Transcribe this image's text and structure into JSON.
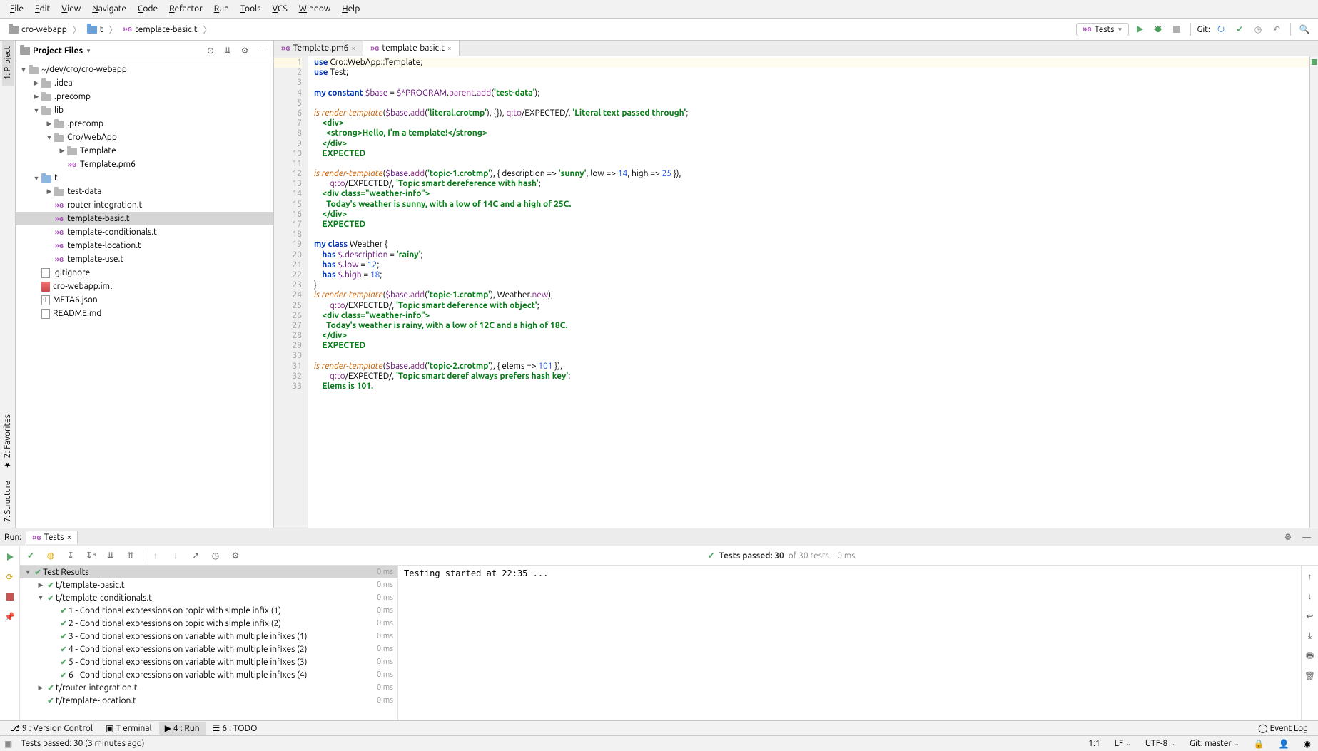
{
  "menubar": [
    "File",
    "Edit",
    "View",
    "Navigate",
    "Code",
    "Refactor",
    "Run",
    "Tools",
    "VCS",
    "Window",
    "Help"
  ],
  "breadcrumb": [
    {
      "icon": "folder",
      "label": "cro-webapp"
    },
    {
      "icon": "folder-blue",
      "label": "t"
    },
    {
      "icon": "raku",
      "label": "template-basic.t"
    }
  ],
  "run_config": {
    "icon": "raku",
    "label": "Tests"
  },
  "git_label": "Git:",
  "project_panel": {
    "title": "Project Files",
    "tree": [
      {
        "depth": 0,
        "arrow": "▼",
        "icon": "folder",
        "label": "~/dev/cro/cro-webapp"
      },
      {
        "depth": 1,
        "arrow": "▶",
        "icon": "folder",
        "label": ".idea"
      },
      {
        "depth": 1,
        "arrow": "▶",
        "icon": "folder",
        "label": ".precomp"
      },
      {
        "depth": 1,
        "arrow": "▼",
        "icon": "folder",
        "label": "lib"
      },
      {
        "depth": 2,
        "arrow": "▶",
        "icon": "folder",
        "label": ".precomp"
      },
      {
        "depth": 2,
        "arrow": "▼",
        "icon": "folder",
        "label": "Cro/WebApp"
      },
      {
        "depth": 3,
        "arrow": "▶",
        "icon": "folder",
        "label": "Template"
      },
      {
        "depth": 3,
        "arrow": "",
        "icon": "raku",
        "label": "Template.pm6"
      },
      {
        "depth": 1,
        "arrow": "▼",
        "icon": "folder-blue",
        "label": "t"
      },
      {
        "depth": 2,
        "arrow": "▶",
        "icon": "folder",
        "label": "test-data"
      },
      {
        "depth": 2,
        "arrow": "",
        "icon": "raku",
        "label": "router-integration.t"
      },
      {
        "depth": 2,
        "arrow": "",
        "icon": "raku",
        "label": "template-basic.t",
        "selected": true
      },
      {
        "depth": 2,
        "arrow": "",
        "icon": "raku",
        "label": "template-conditionals.t"
      },
      {
        "depth": 2,
        "arrow": "",
        "icon": "raku",
        "label": "template-location.t"
      },
      {
        "depth": 2,
        "arrow": "",
        "icon": "raku",
        "label": "template-use.t"
      },
      {
        "depth": 1,
        "arrow": "",
        "icon": "file",
        "label": ".gitignore"
      },
      {
        "depth": 1,
        "arrow": "",
        "icon": "iml",
        "label": "cro-webapp.iml"
      },
      {
        "depth": 1,
        "arrow": "",
        "icon": "json",
        "label": "META6.json"
      },
      {
        "depth": 1,
        "arrow": "",
        "icon": "file",
        "label": "README.md"
      }
    ]
  },
  "left_tabs": [
    "1: Project",
    "2: Favorites",
    "7: Structure"
  ],
  "editor_tabs": [
    {
      "icon": "raku",
      "label": "Template.pm6",
      "active": false
    },
    {
      "icon": "raku",
      "label": "template-basic.t",
      "active": true
    }
  ],
  "code_lines": [
    {
      "n": 1,
      "hl": true,
      "tokens": [
        [
          "kw",
          "use"
        ],
        [
          "typ",
          " Cro::WebApp::Template;"
        ]
      ]
    },
    {
      "n": 2,
      "tokens": [
        [
          "kw",
          "use"
        ],
        [
          "typ",
          " Test;"
        ]
      ]
    },
    {
      "n": 3,
      "tokens": [
        [
          "",
          ""
        ]
      ]
    },
    {
      "n": 4,
      "tokens": [
        [
          "kw",
          "my constant"
        ],
        [
          "",
          " "
        ],
        [
          "var",
          "$base"
        ],
        [
          "",
          " = "
        ],
        [
          "var",
          "$*PROGRAM"
        ],
        [
          "",
          "."
        ],
        [
          "m",
          "parent"
        ],
        [
          "",
          "."
        ],
        [
          "m",
          "add"
        ],
        [
          "",
          "("
        ],
        [
          "str",
          "'test-data'"
        ],
        [
          "",
          ");"
        ]
      ]
    },
    {
      "n": 5,
      "tokens": [
        [
          "",
          ""
        ]
      ]
    },
    {
      "n": 6,
      "tokens": [
        [
          "fn",
          "is"
        ],
        [
          "",
          " "
        ],
        [
          "fn",
          "render-template"
        ],
        [
          "",
          "("
        ],
        [
          "var",
          "$base"
        ],
        [
          "",
          "."
        ],
        [
          "m",
          "add"
        ],
        [
          "",
          "("
        ],
        [
          "str",
          "'literal.crotmp'"
        ],
        [
          "",
          "), {}), "
        ],
        [
          "m",
          "q:to"
        ],
        [
          "",
          "/EXPECTED/, "
        ],
        [
          "str",
          "'Literal text passed through'"
        ],
        [
          "",
          ";"
        ]
      ]
    },
    {
      "n": 7,
      "tokens": [
        [
          "str",
          "    <div>"
        ]
      ]
    },
    {
      "n": 8,
      "tokens": [
        [
          "str",
          "      <strong>Hello, I'm a template!</strong>"
        ]
      ]
    },
    {
      "n": 9,
      "tokens": [
        [
          "str",
          "    </div>"
        ]
      ]
    },
    {
      "n": 10,
      "tokens": [
        [
          "str",
          "    EXPECTED"
        ]
      ]
    },
    {
      "n": 11,
      "tokens": [
        [
          "",
          ""
        ]
      ]
    },
    {
      "n": 12,
      "tokens": [
        [
          "fn",
          "is"
        ],
        [
          "",
          " "
        ],
        [
          "fn",
          "render-template"
        ],
        [
          "",
          "("
        ],
        [
          "var",
          "$base"
        ],
        [
          "",
          "."
        ],
        [
          "m",
          "add"
        ],
        [
          "",
          "("
        ],
        [
          "str",
          "'topic-1.crotmp'"
        ],
        [
          "",
          "), { description => "
        ],
        [
          "str",
          "'sunny'"
        ],
        [
          "",
          ", low => "
        ],
        [
          "num",
          "14"
        ],
        [
          "",
          ", high => "
        ],
        [
          "num",
          "25"
        ],
        [
          "",
          " }),"
        ]
      ]
    },
    {
      "n": 13,
      "tokens": [
        [
          "",
          "        "
        ],
        [
          "m",
          "q:to"
        ],
        [
          "",
          "/EXPECTED/, "
        ],
        [
          "str",
          "'Topic smart dereference with hash'"
        ],
        [
          "",
          ";"
        ]
      ]
    },
    {
      "n": 14,
      "tokens": [
        [
          "str",
          "    <div class=\"weather-info\">"
        ]
      ]
    },
    {
      "n": 15,
      "tokens": [
        [
          "str",
          "      Today's weather is sunny, with a low of 14C and a high of 25C."
        ]
      ]
    },
    {
      "n": 16,
      "tokens": [
        [
          "str",
          "    </div>"
        ]
      ]
    },
    {
      "n": 17,
      "tokens": [
        [
          "str",
          "    EXPECTED"
        ]
      ]
    },
    {
      "n": 18,
      "tokens": [
        [
          "",
          ""
        ]
      ]
    },
    {
      "n": 19,
      "tokens": [
        [
          "kw",
          "my class"
        ],
        [
          "",
          " Weather {"
        ]
      ]
    },
    {
      "n": 20,
      "tokens": [
        [
          "kw",
          "    has"
        ],
        [
          "",
          " "
        ],
        [
          "var",
          "$.description"
        ],
        [
          "",
          " = "
        ],
        [
          "str",
          "'rainy'"
        ],
        [
          "",
          ";"
        ]
      ]
    },
    {
      "n": 21,
      "tokens": [
        [
          "kw",
          "    has"
        ],
        [
          "",
          " "
        ],
        [
          "var",
          "$.low"
        ],
        [
          "",
          " = "
        ],
        [
          "num",
          "12"
        ],
        [
          "",
          ";"
        ]
      ]
    },
    {
      "n": 22,
      "tokens": [
        [
          "kw",
          "    has"
        ],
        [
          "",
          " "
        ],
        [
          "var",
          "$.high"
        ],
        [
          "",
          " = "
        ],
        [
          "num",
          "18"
        ],
        [
          "",
          ";"
        ]
      ]
    },
    {
      "n": 23,
      "tokens": [
        [
          "",
          "}"
        ]
      ]
    },
    {
      "n": 24,
      "tokens": [
        [
          "fn",
          "is"
        ],
        [
          "",
          " "
        ],
        [
          "fn",
          "render-template"
        ],
        [
          "",
          "("
        ],
        [
          "var",
          "$base"
        ],
        [
          "",
          "."
        ],
        [
          "m",
          "add"
        ],
        [
          "",
          "("
        ],
        [
          "str",
          "'topic-1.crotmp'"
        ],
        [
          "",
          "), Weather."
        ],
        [
          "m",
          "new"
        ],
        [
          "",
          "),"
        ]
      ]
    },
    {
      "n": 25,
      "tokens": [
        [
          "",
          "        "
        ],
        [
          "m",
          "q:to"
        ],
        [
          "",
          "/EXPECTED/, "
        ],
        [
          "str",
          "'Topic smart deference with object'"
        ],
        [
          "",
          ";"
        ]
      ]
    },
    {
      "n": 26,
      "tokens": [
        [
          "str",
          "    <div class=\"weather-info\">"
        ]
      ]
    },
    {
      "n": 27,
      "tokens": [
        [
          "str",
          "      Today's weather is rainy, with a low of 12C and a high of 18C."
        ]
      ]
    },
    {
      "n": 28,
      "tokens": [
        [
          "str",
          "    </div>"
        ]
      ]
    },
    {
      "n": 29,
      "tokens": [
        [
          "str",
          "    EXPECTED"
        ]
      ]
    },
    {
      "n": 30,
      "tokens": [
        [
          "",
          ""
        ]
      ]
    },
    {
      "n": 31,
      "tokens": [
        [
          "fn",
          "is"
        ],
        [
          "",
          " "
        ],
        [
          "fn",
          "render-template"
        ],
        [
          "",
          "("
        ],
        [
          "var",
          "$base"
        ],
        [
          "",
          "."
        ],
        [
          "m",
          "add"
        ],
        [
          "",
          "("
        ],
        [
          "str",
          "'topic-2.crotmp'"
        ],
        [
          "",
          "), { elems => "
        ],
        [
          "num",
          "101"
        ],
        [
          "",
          " }),"
        ]
      ]
    },
    {
      "n": 32,
      "tokens": [
        [
          "",
          "        "
        ],
        [
          "m",
          "q:to"
        ],
        [
          "",
          "/EXPECTED/, "
        ],
        [
          "str",
          "'Topic smart deref always prefers hash key'"
        ],
        [
          "",
          ";"
        ]
      ]
    },
    {
      "n": 33,
      "tokens": [
        [
          "str",
          "    Elems is 101."
        ]
      ]
    }
  ],
  "run": {
    "label": "Run:",
    "tab": "Tests",
    "status": {
      "passed": "Tests passed: 30",
      "of": "of 30 tests – 0 ms"
    },
    "tree": [
      {
        "depth": 0,
        "arrow": "▼",
        "tick": true,
        "label": "Test Results",
        "time": "0 ms",
        "root": true
      },
      {
        "depth": 1,
        "arrow": "▶",
        "tick": true,
        "label": "t/template-basic.t",
        "time": "0 ms"
      },
      {
        "depth": 1,
        "arrow": "▼",
        "tick": true,
        "label": "t/template-conditionals.t",
        "time": "0 ms"
      },
      {
        "depth": 2,
        "arrow": "",
        "tick": true,
        "label": "1 - Conditional expressions on topic with simple infix (1)",
        "time": "0 ms"
      },
      {
        "depth": 2,
        "arrow": "",
        "tick": true,
        "label": "2 - Conditional expressions on topic with simple infix (2)",
        "time": "0 ms"
      },
      {
        "depth": 2,
        "arrow": "",
        "tick": true,
        "label": "3 - Conditional expressions on variable with multiple infixes (1)",
        "time": "0 ms"
      },
      {
        "depth": 2,
        "arrow": "",
        "tick": true,
        "label": "4 - Conditional expressions on variable with multiple infixes (2)",
        "time": "0 ms"
      },
      {
        "depth": 2,
        "arrow": "",
        "tick": true,
        "label": "5 - Conditional expressions on variable with multiple infixes (3)",
        "time": "0 ms"
      },
      {
        "depth": 2,
        "arrow": "",
        "tick": true,
        "label": "6 - Conditional expressions on variable with multiple infixes (4)",
        "time": "0 ms"
      },
      {
        "depth": 1,
        "arrow": "▶",
        "tick": true,
        "label": "t/router-integration.t",
        "time": "0 ms"
      },
      {
        "depth": 1,
        "arrow": "",
        "tick": true,
        "label": "t/template-location.t",
        "time": "0 ms"
      }
    ],
    "console": "Testing started at 22:35 ..."
  },
  "bottom_tabs": [
    {
      "icon": "branch",
      "label": "9: Version Control"
    },
    {
      "icon": "terminal",
      "label": "Terminal"
    },
    {
      "icon": "play",
      "label": "4: Run",
      "active": true
    },
    {
      "icon": "list",
      "label": "6: TODO"
    }
  ],
  "event_log": "Event Log",
  "status": {
    "msg": "Tests passed: 30 (3 minutes ago)",
    "caret": "1:1",
    "le": "LF",
    "enc": "UTF-8",
    "git": "Git: master"
  }
}
